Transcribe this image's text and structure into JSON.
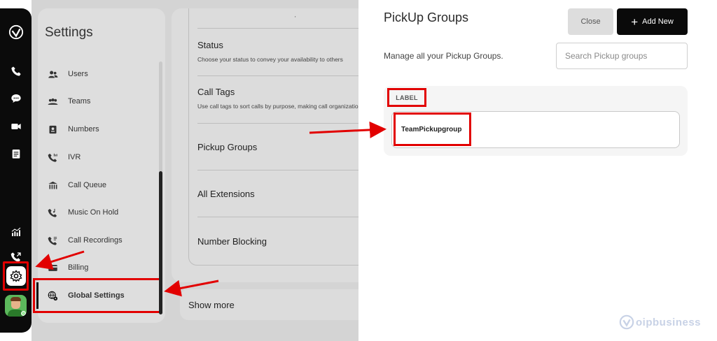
{
  "sidebar": {
    "title": "Settings",
    "items": [
      {
        "label": "Users",
        "icon": "users-icon"
      },
      {
        "label": "Teams",
        "icon": "teams-icon"
      },
      {
        "label": "Numbers",
        "icon": "numbers-icon"
      },
      {
        "label": "IVR",
        "icon": "ivr-icon"
      },
      {
        "label": "Call Queue",
        "icon": "call-queue-icon"
      },
      {
        "label": "Music On Hold",
        "icon": "music-on-hold-icon"
      },
      {
        "label": "Call Recordings",
        "icon": "call-recordings-icon"
      },
      {
        "label": "Billing",
        "icon": "billing-icon"
      },
      {
        "label": "Global Settings",
        "icon": "globe-gear-icon"
      }
    ]
  },
  "main": {
    "sections": [
      {
        "title": "Status",
        "desc": "Choose your status to convey your availability to others"
      },
      {
        "title": "Call Tags",
        "desc": "Use call tags to sort calls by purpose, making call organization easier"
      },
      {
        "title": "Pickup Groups",
        "desc": ""
      },
      {
        "title": "All Extensions",
        "desc": ""
      },
      {
        "title": "Number Blocking",
        "desc": ""
      }
    ],
    "show_more": "Show more",
    "tick": "'"
  },
  "drawer": {
    "title": "PickUp Groups",
    "close_label": "Close",
    "add_label": "Add New",
    "description": "Manage all your Pickup Groups.",
    "search_placeholder": "Search Pickup groups",
    "column_header": "LABEL",
    "rows": [
      "TeamPickupgroup"
    ]
  },
  "watermark": "oipbusiness",
  "colors": {
    "highlight": "#e20000",
    "rail": "#0b0b0b",
    "accent_button": "#0a0a0a"
  }
}
